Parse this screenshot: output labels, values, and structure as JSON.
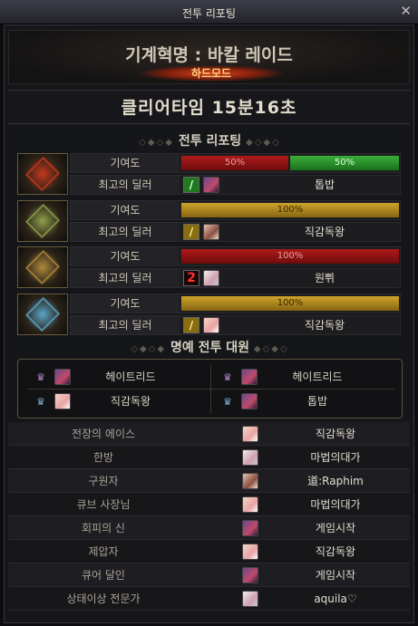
{
  "window": {
    "title": "전투 리포팅",
    "close_glyph": "✕"
  },
  "header": {
    "raid_name": "기계혁명 : 바칼 레이드",
    "mode": "하드모드"
  },
  "clear_time": "클리어타임  15분16초",
  "sections": {
    "battle_report": "전투 리포팅",
    "honor_members": "명예 전투 대원"
  },
  "labels": {
    "contribution": "기여도",
    "best_dealer": "최고의 딜러"
  },
  "raids": [
    {
      "boss_icon": "fire-boss-icon",
      "boss_color": "#c8381c",
      "contribution": [
        {
          "label": "50%",
          "value": 50,
          "color": "red"
        },
        {
          "label": "50%",
          "value": 50,
          "color": "green"
        }
      ],
      "dealer_badge": "/",
      "dealer_badge_color": "green",
      "dealer_name": "톱밥"
    },
    {
      "boss_icon": "forest-boss-icon",
      "boss_color": "#8fa04a",
      "contribution": [
        {
          "label": "100%",
          "value": 100,
          "color": "gold"
        }
      ],
      "dealer_badge": "/",
      "dealer_badge_color": "yellow",
      "dealer_name": "직감독왕"
    },
    {
      "boss_icon": "gold-boss-icon",
      "boss_color": "#b08a3a",
      "contribution": [
        {
          "label": "100%",
          "value": 100,
          "color": "red"
        }
      ],
      "dealer_badge": "2",
      "dealer_badge_color": "red",
      "dealer_name": "원쀠"
    },
    {
      "boss_icon": "ice-boss-icon",
      "boss_color": "#5aa6c8",
      "contribution": [
        {
          "label": "100%",
          "value": 100,
          "color": "gold"
        }
      ],
      "dealer_badge": "/",
      "dealer_badge_color": "yellow",
      "dealer_name": "직감독왕"
    }
  ],
  "honor": [
    {
      "name": "헤이트리드",
      "crown": "purple"
    },
    {
      "name": "헤이트리드",
      "crown": "purple"
    },
    {
      "name": "직감독왕",
      "crown": "blue"
    },
    {
      "name": "톱밥",
      "crown": "blue"
    }
  ],
  "awards": [
    {
      "title": "전장의 에이스",
      "player": "직감독왕"
    },
    {
      "title": "한방",
      "player": "마법의대가"
    },
    {
      "title": "구원자",
      "player": "道:Raphim"
    },
    {
      "title": "큐브 사장님",
      "player": "마법의대가"
    },
    {
      "title": "회피의 신",
      "player": "게임시작"
    },
    {
      "title": "제압자",
      "player": "직감독왕"
    },
    {
      "title": "큐어 달인",
      "player": "게임시작"
    },
    {
      "title": "상태이상 전문가",
      "player": "aquila♡"
    }
  ]
}
